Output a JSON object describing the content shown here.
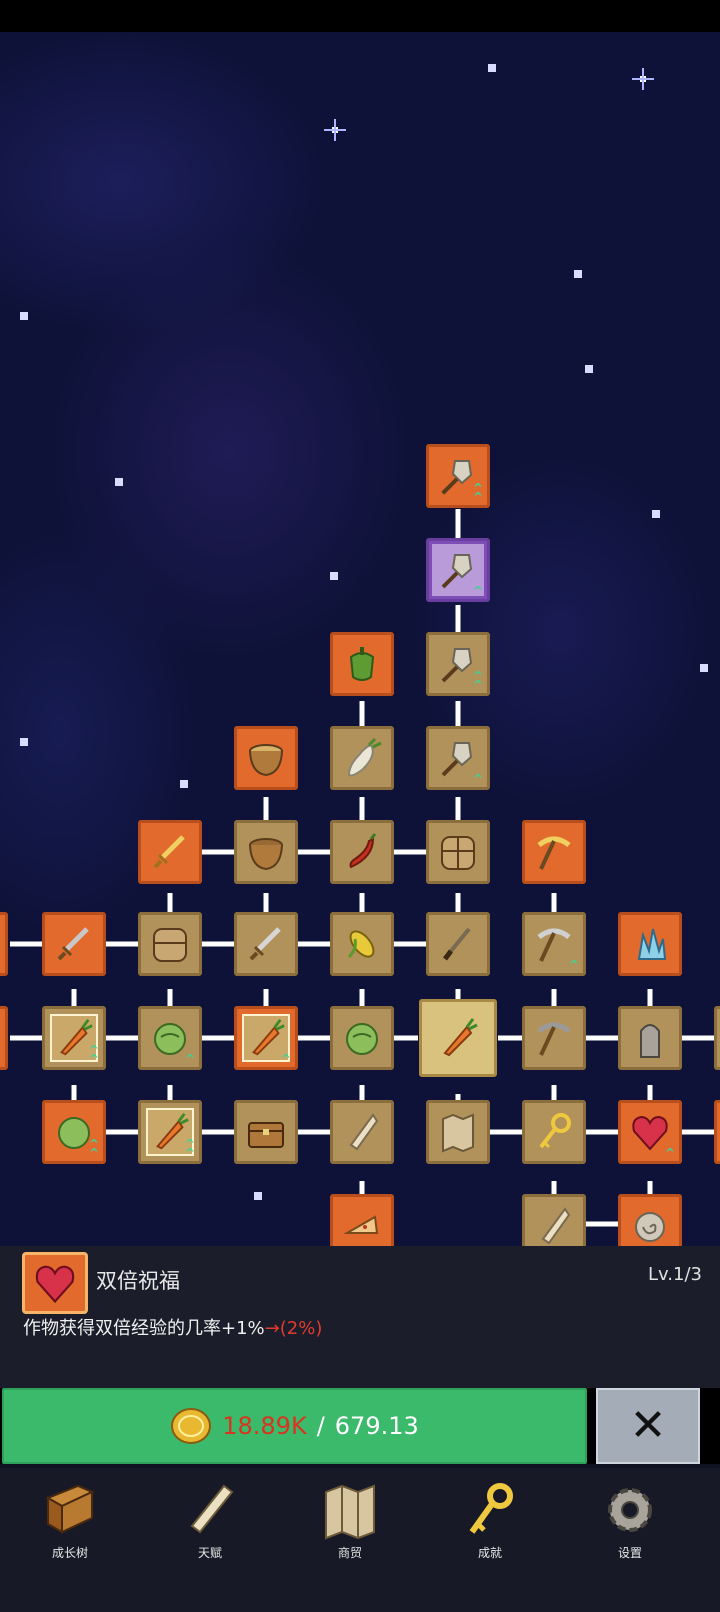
{
  "info": {
    "skill_name": "双倍祝福",
    "level": "Lv.1/3",
    "description": "作物获得双倍经验的几率+1%",
    "arrow": "→",
    "next_value": "(2%)"
  },
  "action": {
    "coins_have": "18.89K",
    "separator": "/",
    "cost": "679.13"
  },
  "nav": {
    "tree": "成长树",
    "talent": "天赋",
    "trade": "商贸",
    "achievement": "成就",
    "settings": "设置"
  },
  "colors": {
    "orange_node": "#e26a2c",
    "tan_node": "#b1925a",
    "upgrade_button": "#3cba6b",
    "cost_red": "#d9341f"
  }
}
